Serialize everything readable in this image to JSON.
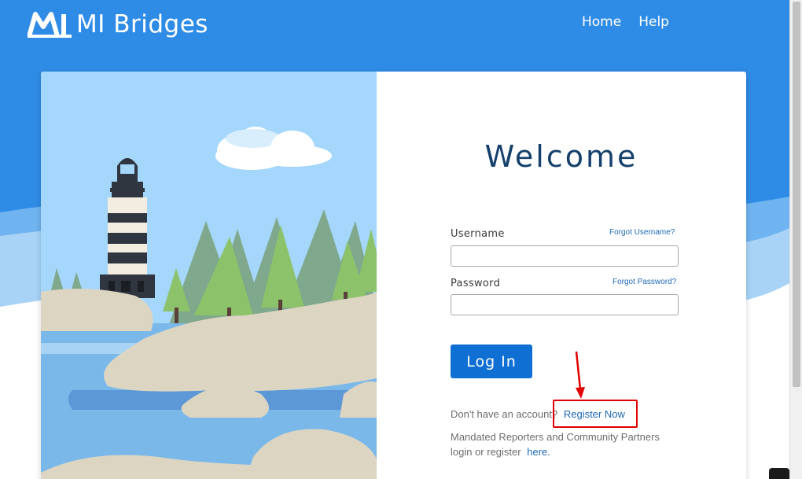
{
  "header": {
    "brand": "MI Bridges",
    "nav": [
      "Home",
      "Help"
    ]
  },
  "login": {
    "title": "Welcome",
    "username_label": "Username",
    "forgot_username": "Forgot Username?",
    "password_label": "Password",
    "forgot_password": "Forgot Password?",
    "username_value": "",
    "password_value": "",
    "login_button": "Log In",
    "no_account_text": "Don't have an account?",
    "register_link": "Register Now",
    "partners_text_1": "Mandated Reporters and Community Partners",
    "partners_text_2": "login or register",
    "partners_link": "here."
  },
  "colors": {
    "brand_blue": "#2f8ce6",
    "button_blue": "#0f6fd3",
    "title_navy": "#14406b",
    "annotation_red": "#e00000"
  }
}
